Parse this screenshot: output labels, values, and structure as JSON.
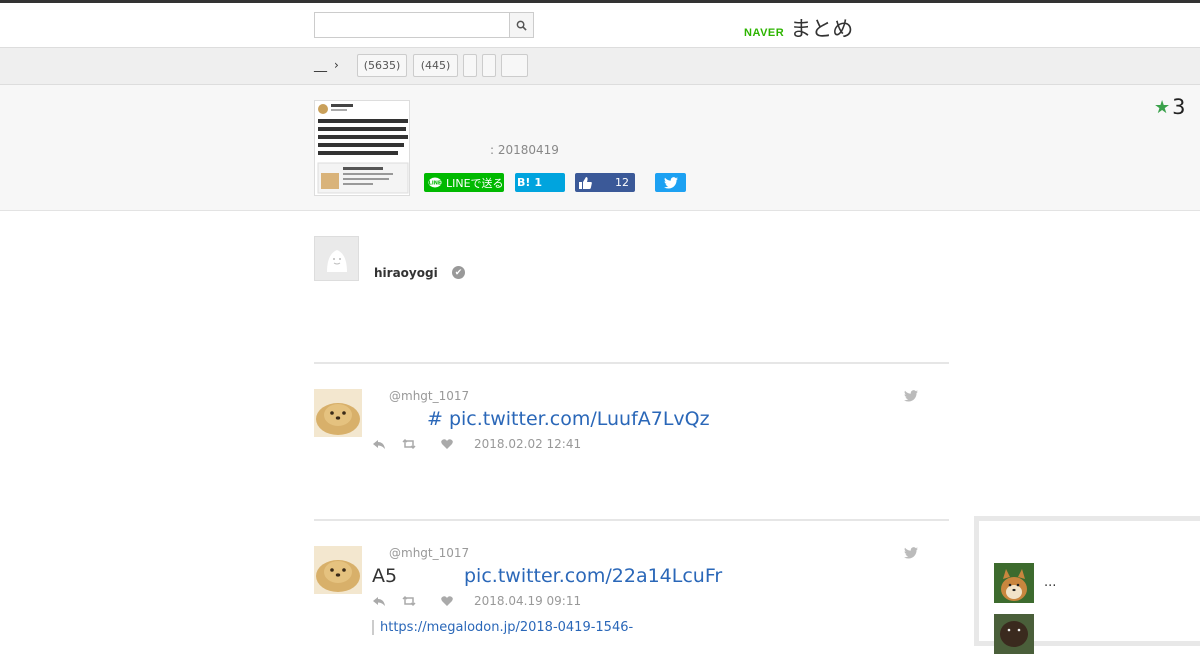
{
  "search": {
    "placeholder": "",
    "value": ""
  },
  "logo": {
    "brand": "NAVER",
    "name": "まとめ"
  },
  "breadcrumb": {
    "home": "__",
    "arrow": "›",
    "tags": [
      "(5635)",
      "(445)",
      "",
      "",
      ""
    ]
  },
  "summary": {
    "date": ": 20180419",
    "favorites": "3",
    "share": {
      "line": "LINEで送る",
      "hatena_logo": "B!",
      "hatena_count": "1",
      "facebook_count": "12"
    }
  },
  "author": {
    "name": "hiraoyogi"
  },
  "tweets": [
    {
      "user": "@mhgt_1017",
      "text_prefix": "#",
      "link": "pic.twitter.com/LuufA7LvQz",
      "time": "2018.02.02 12:41"
    },
    {
      "user": "@mhgt_1017",
      "text_prefix": "A5",
      "link": "pic.twitter.com/22a14LcuFr",
      "time": "2018.04.19 09:11",
      "url": "https://megalodon.jp/2018-0419-1546-"
    }
  ],
  "sidebar": {
    "item_text": "..."
  },
  "colors": {
    "accent_green": "#2db400",
    "link_blue": "#2a67b8",
    "line_green": "#00b900",
    "hatena_blue": "#00a4de",
    "facebook_blue": "#3b5998",
    "twitter_blue": "#1da1f2"
  },
  "icons": [
    "search-icon",
    "star-icon",
    "like-icon",
    "twitter-bird-icon",
    "reply-icon",
    "retweet-icon",
    "heart-icon",
    "verified-icon",
    "default-avatar-icon"
  ]
}
